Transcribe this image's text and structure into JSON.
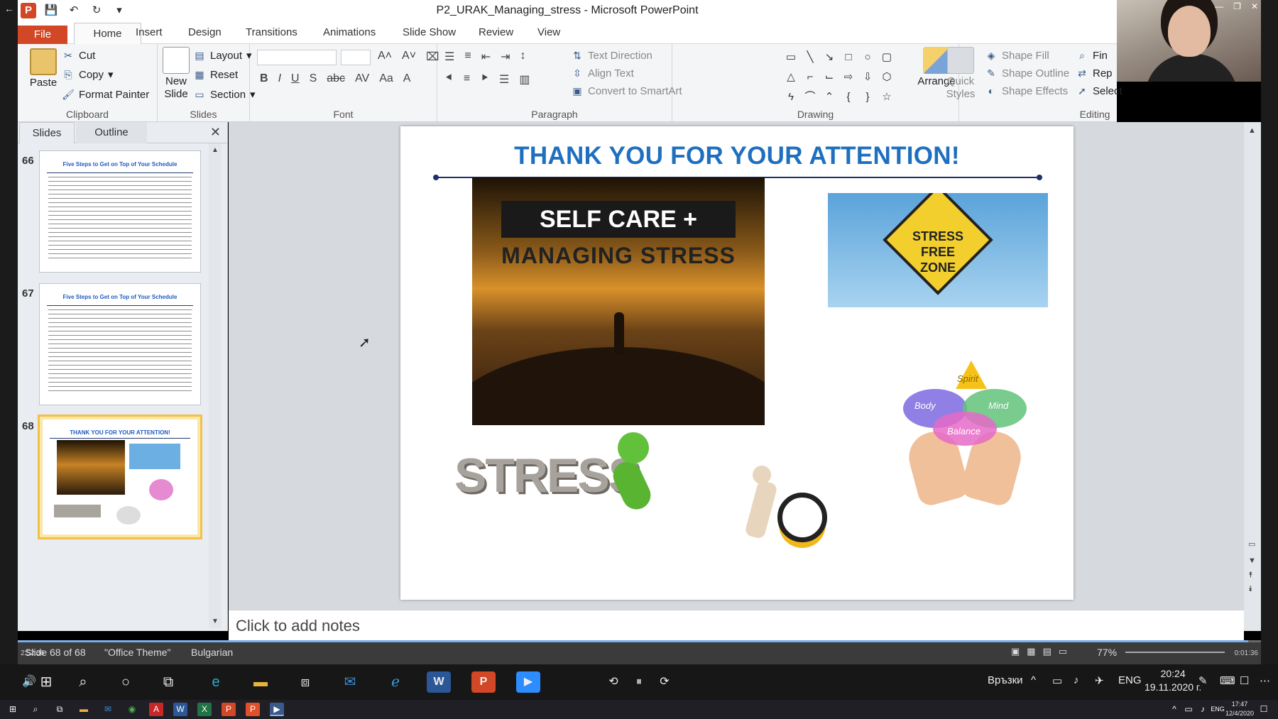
{
  "window": {
    "title": "P2_URAK_Managing_stress  -  Microsoft PowerPoint"
  },
  "ribbon_tabs": [
    "File",
    "Home",
    "Insert",
    "Design",
    "Transitions",
    "Animations",
    "Slide Show",
    "Review",
    "View"
  ],
  "clipboard": {
    "paste": "Paste",
    "cut": "Cut",
    "copy": "Copy",
    "format_painter": "Format Painter",
    "label": "Clipboard"
  },
  "slides_group": {
    "new_slide": "New Slide",
    "layout": "Layout",
    "reset": "Reset",
    "section": "Section",
    "label": "Slides"
  },
  "font_group": {
    "label": "Font",
    "font_name": "",
    "font_size": ""
  },
  "paragraph": {
    "text_direction": "Text Direction",
    "align_text": "Align Text",
    "convert_smartart": "Convert to SmartArt",
    "label": "Paragraph"
  },
  "drawing": {
    "arrange": "Arrange",
    "quick_styles": "Quick Styles",
    "shape_fill": "Shape Fill",
    "shape_outline": "Shape Outline",
    "shape_effects": "Shape Effects",
    "label": "Drawing"
  },
  "editing": {
    "find": "Fin",
    "replace": "Rep",
    "select": "Select",
    "label": "Editing"
  },
  "pane": {
    "tab_slides": "Slides",
    "tab_outline": "Outline"
  },
  "thumbnails": [
    {
      "number": "66",
      "title": "Five Steps to Get on Top of Your Schedule"
    },
    {
      "number": "67",
      "title": "Five Steps to Get on Top of Your Schedule"
    },
    {
      "number": "68",
      "title": "THANK YOU FOR YOUR ATTENTION!",
      "selected": true
    }
  ],
  "slide": {
    "title": "THANK YOU FOR YOUR ATTENTION!",
    "selfcare_line1": "SELF CARE +",
    "selfcare_line2": "MANAGING STRESS",
    "sign_text": "STRESS FREE ZONE",
    "stress_word": "STRESS",
    "spirit": "Spirit",
    "body": "Body",
    "mind": "Mind",
    "balance": "Balance"
  },
  "notes": {
    "placeholder": "Click to add notes"
  },
  "status": {
    "slide_info": "Slide 68 of 68",
    "theme": "\"Office Theme\"",
    "language": "Bulgarian",
    "zoom": "77%",
    "elapsed": "2:52:36",
    "remaining": "0:01:36",
    "progress": 0.99
  },
  "tray": {
    "links": "Връзки",
    "lang": "ENG",
    "time": "20:24",
    "date": "19.11.2020 г.",
    "tb_lang": "ENG",
    "tb_time": "17:47",
    "tb_date": "12/4/2020"
  }
}
